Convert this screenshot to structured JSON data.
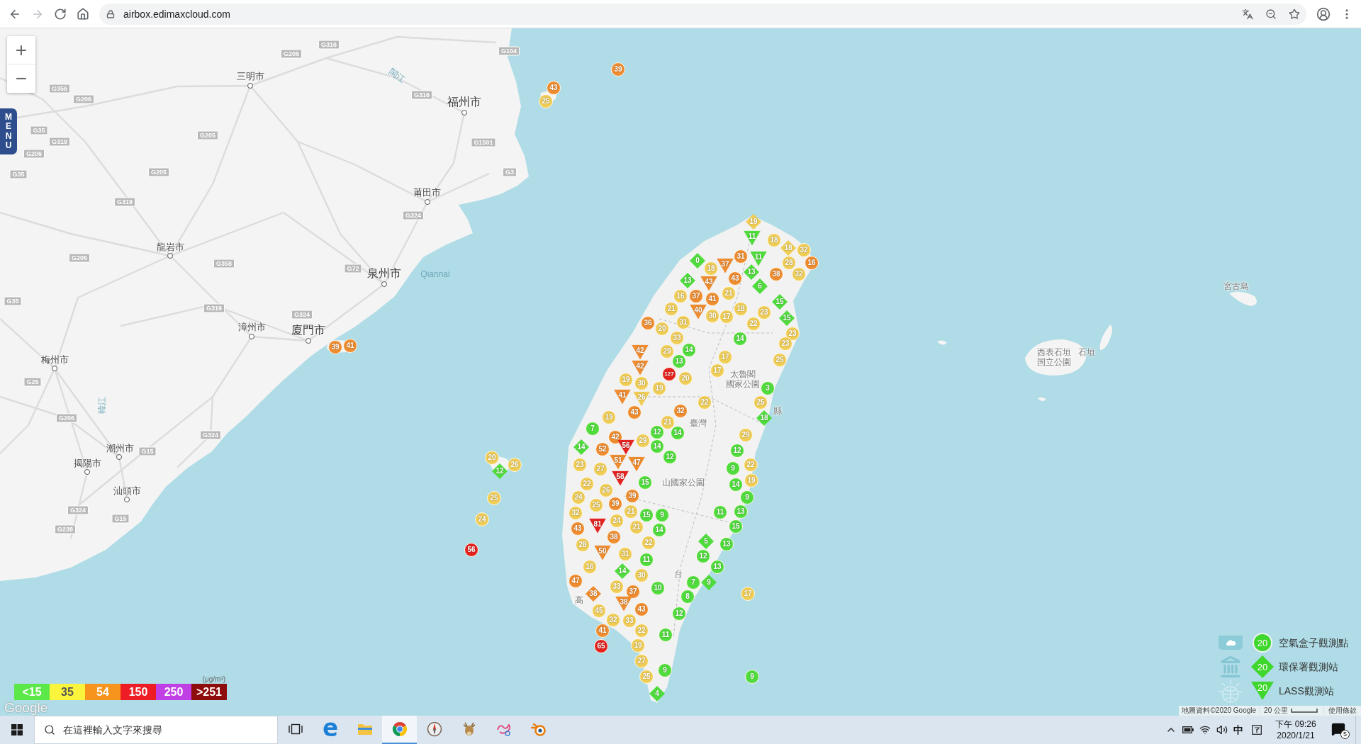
{
  "browser": {
    "url": "airbox.edimaxcloud.com"
  },
  "map": {
    "zoom_controls": [
      "+",
      "−"
    ],
    "menu_tab": "MENU",
    "city_labels": [
      {
        "name": "三明市",
        "kind": "city"
      },
      {
        "name": "福州市",
        "kind": "major_city"
      },
      {
        "name": "莆田市",
        "kind": "city"
      },
      {
        "name": "龍岩市",
        "kind": "city"
      },
      {
        "name": "泉州市",
        "kind": "major_city"
      },
      {
        "name": "漳州市",
        "kind": "city"
      },
      {
        "name": "廈門市",
        "kind": "major_city"
      },
      {
        "name": "梅州市",
        "kind": "city"
      },
      {
        "name": "潮州市",
        "kind": "city"
      },
      {
        "name": "揭陽市",
        "kind": "city"
      },
      {
        "name": "汕頭市",
        "kind": "city"
      }
    ],
    "road_labels": [
      "G316",
      "G205",
      "G104",
      "G356",
      "G206",
      "G316",
      "G35",
      "G205",
      "G319",
      "G1501",
      "G206",
      "G35",
      "G205",
      "G3",
      "G319",
      "G324",
      "G205",
      "G358",
      "G72",
      "G35",
      "G319",
      "G324",
      "G25",
      "G206",
      "G324",
      "G15",
      "G324",
      "G15",
      "G238"
    ],
    "water_labels": [
      "閩江",
      "韓江",
      "Qiannai"
    ],
    "place_labels": [
      "太魯閣",
      "國家公園",
      "臺灣",
      "山國家公園",
      "縣",
      "高",
      "台",
      "宮古島",
      "西表石垣",
      "国立公園",
      "石垣"
    ],
    "markers": [
      {
        "kind": "circle",
        "value": "39",
        "color": "#ef8c2f"
      },
      {
        "kind": "circle",
        "value": "43",
        "color": "#ef8c2f"
      },
      {
        "kind": "circle",
        "value": "25",
        "color": "#f0cd55"
      },
      {
        "kind": "diamond",
        "value": "19",
        "color": "#f0cd55"
      },
      {
        "kind": "triangle",
        "value": "11",
        "color": "#4fdc3c"
      },
      {
        "kind": "circle",
        "value": "18",
        "color": "#f0cd55"
      },
      {
        "kind": "diamond",
        "value": "18",
        "color": "#f0cd55"
      },
      {
        "kind": "circle",
        "value": "32",
        "color": "#f0cd55"
      },
      {
        "kind": "diamond",
        "value": "0",
        "color": "#4fdc3c"
      },
      {
        "kind": "circle",
        "value": "18",
        "color": "#f0cd55"
      },
      {
        "kind": "triangle",
        "value": "37",
        "color": "#ef8c2f"
      },
      {
        "kind": "circle",
        "value": "31",
        "color": "#ef8c2f"
      },
      {
        "kind": "diamond",
        "value": "13",
        "color": "#4fdc3c"
      },
      {
        "kind": "triangle",
        "value": "11",
        "color": "#4fdc3c"
      },
      {
        "kind": "circle",
        "value": "28",
        "color": "#f0cd55"
      },
      {
        "kind": "circle",
        "value": "16",
        "color": "#ef8c2f"
      },
      {
        "kind": "diamond",
        "value": "13",
        "color": "#4fdc3c"
      },
      {
        "kind": "circle",
        "value": "43",
        "color": "#ef8c2f"
      },
      {
        "kind": "circle",
        "value": "38",
        "color": "#ef8c2f"
      },
      {
        "kind": "circle",
        "value": "32",
        "color": "#f0cd55"
      },
      {
        "kind": "triangle",
        "value": "43",
        "color": "#ef8c2f"
      },
      {
        "kind": "diamond",
        "value": "6",
        "color": "#4fdc3c"
      },
      {
        "kind": "circle",
        "value": "16",
        "color": "#f0cd55"
      },
      {
        "kind": "circle",
        "value": "37",
        "color": "#ef8c2f"
      },
      {
        "kind": "circle",
        "value": "41",
        "color": "#ef8c2f"
      },
      {
        "kind": "circle",
        "value": "21",
        "color": "#f0cd55"
      },
      {
        "kind": "diamond",
        "value": "15",
        "color": "#4fdc3c"
      },
      {
        "kind": "circle",
        "value": "21",
        "color": "#f0cd55"
      },
      {
        "kind": "triangle",
        "value": "40",
        "color": "#ef8c2f"
      },
      {
        "kind": "circle",
        "value": "18",
        "color": "#f0cd55"
      },
      {
        "kind": "circle",
        "value": "23",
        "color": "#f0cd55"
      },
      {
        "kind": "circle",
        "value": "36",
        "color": "#ef8c2f"
      },
      {
        "kind": "circle",
        "value": "20",
        "color": "#f0cd55"
      },
      {
        "kind": "circle",
        "value": "31",
        "color": "#f0cd55"
      },
      {
        "kind": "circle",
        "value": "30",
        "color": "#f0cd55"
      },
      {
        "kind": "circle",
        "value": "17",
        "color": "#f0cd55"
      },
      {
        "kind": "circle",
        "value": "22",
        "color": "#f0cd55"
      },
      {
        "kind": "diamond",
        "value": "15",
        "color": "#4fdc3c"
      },
      {
        "kind": "circle",
        "value": "33",
        "color": "#f0cd55"
      },
      {
        "kind": "circle",
        "value": "14",
        "color": "#4fdc3c"
      },
      {
        "kind": "circle",
        "value": "23",
        "color": "#f0cd55"
      },
      {
        "kind": "circle",
        "value": "39",
        "color": "#ef8c2f"
      },
      {
        "kind": "circle",
        "value": "41",
        "color": "#ef8c2f"
      },
      {
        "kind": "circle",
        "value": "14",
        "color": "#4fdc3c"
      },
      {
        "kind": "circle",
        "value": "23",
        "color": "#f0cd55"
      },
      {
        "kind": "triangle",
        "value": "42",
        "color": "#ef8c2f"
      },
      {
        "kind": "circle",
        "value": "29",
        "color": "#f0cd55"
      },
      {
        "kind": "circle",
        "value": "13",
        "color": "#4fdc3c"
      },
      {
        "kind": "circle",
        "value": "17",
        "color": "#f0cd55"
      },
      {
        "kind": "circle",
        "value": "25",
        "color": "#f0cd55"
      },
      {
        "kind": "triangle",
        "value": "42",
        "color": "#ef8c2f"
      },
      {
        "kind": "circle",
        "value": "127",
        "color": "#e42320"
      },
      {
        "kind": "circle",
        "value": "17",
        "color": "#f0cd55"
      },
      {
        "kind": "circle",
        "value": "19",
        "color": "#f0cd55"
      },
      {
        "kind": "circle",
        "value": "30",
        "color": "#f0cd55"
      },
      {
        "kind": "circle",
        "value": "20",
        "color": "#f0cd55"
      },
      {
        "kind": "circle",
        "value": "19",
        "color": "#f0cd55"
      },
      {
        "kind": "circle",
        "value": "3",
        "color": "#4fdc3c"
      },
      {
        "kind": "triangle",
        "value": "41",
        "color": "#ef8c2f"
      },
      {
        "kind": "triangle",
        "value": "26",
        "color": "#f0cd55"
      },
      {
        "kind": "circle",
        "value": "22",
        "color": "#f0cd55"
      },
      {
        "kind": "circle",
        "value": "25",
        "color": "#f0cd55"
      },
      {
        "kind": "circle",
        "value": "19",
        "color": "#f0cd55"
      },
      {
        "kind": "circle",
        "value": "43",
        "color": "#ef8c2f"
      },
      {
        "kind": "circle",
        "value": "32",
        "color": "#ef8c2f"
      },
      {
        "kind": "circle",
        "value": "21",
        "color": "#f0cd55"
      },
      {
        "kind": "diamond",
        "value": "18",
        "color": "#4fdc3c"
      },
      {
        "kind": "circle",
        "value": "7",
        "color": "#4fdc3c"
      },
      {
        "kind": "circle",
        "value": "42",
        "color": "#ef8c2f"
      },
      {
        "kind": "circle",
        "value": "29",
        "color": "#f0cd55"
      },
      {
        "kind": "circle",
        "value": "12",
        "color": "#4fdc3c"
      },
      {
        "kind": "circle",
        "value": "14",
        "color": "#4fdc3c"
      },
      {
        "kind": "circle",
        "value": "29",
        "color": "#f0cd55"
      },
      {
        "kind": "diamond",
        "value": "14",
        "color": "#4fdc3c"
      },
      {
        "kind": "circle",
        "value": "52",
        "color": "#ef8c2f"
      },
      {
        "kind": "triangle",
        "value": "56",
        "color": "#e42320"
      },
      {
        "kind": "circle",
        "value": "14",
        "color": "#4fdc3c"
      },
      {
        "kind": "circle",
        "value": "12",
        "color": "#4fdc3c"
      },
      {
        "kind": "circle",
        "value": "20",
        "color": "#f0cd55"
      },
      {
        "kind": "triangle",
        "value": "51",
        "color": "#ef8c2f"
      },
      {
        "kind": "circle",
        "value": "12",
        "color": "#4fdc3c"
      },
      {
        "kind": "circle",
        "value": "26",
        "color": "#f0cd55"
      },
      {
        "kind": "circle",
        "value": "23",
        "color": "#f0cd55"
      },
      {
        "kind": "circle",
        "value": "27",
        "color": "#f0cd55"
      },
      {
        "kind": "triangle",
        "value": "47",
        "color": "#ef8c2f"
      },
      {
        "kind": "circle",
        "value": "9",
        "color": "#4fdc3c"
      },
      {
        "kind": "circle",
        "value": "22",
        "color": "#f0cd55"
      },
      {
        "kind": "diamond",
        "value": "12",
        "color": "#4fdc3c"
      },
      {
        "kind": "circle",
        "value": "22",
        "color": "#f0cd55"
      },
      {
        "kind": "triangle",
        "value": "58",
        "color": "#e42320"
      },
      {
        "kind": "circle",
        "value": "15",
        "color": "#4fdc3c"
      },
      {
        "kind": "circle",
        "value": "14",
        "color": "#4fdc3c"
      },
      {
        "kind": "circle",
        "value": "19",
        "color": "#f0cd55"
      },
      {
        "kind": "circle",
        "value": "25",
        "color": "#f0cd55"
      },
      {
        "kind": "circle",
        "value": "24",
        "color": "#f0cd55"
      },
      {
        "kind": "circle",
        "value": "26",
        "color": "#f0cd55"
      },
      {
        "kind": "circle",
        "value": "39",
        "color": "#ef8c2f"
      },
      {
        "kind": "circle",
        "value": "39",
        "color": "#ef8c2f"
      },
      {
        "kind": "circle",
        "value": "9",
        "color": "#4fdc3c"
      },
      {
        "kind": "circle",
        "value": "32",
        "color": "#f0cd55"
      },
      {
        "kind": "circle",
        "value": "25",
        "color": "#f0cd55"
      },
      {
        "kind": "circle",
        "value": "21",
        "color": "#f0cd55"
      },
      {
        "kind": "circle",
        "value": "15",
        "color": "#4fdc3c"
      },
      {
        "kind": "circle",
        "value": "9",
        "color": "#4fdc3c"
      },
      {
        "kind": "circle",
        "value": "11",
        "color": "#4fdc3c"
      },
      {
        "kind": "circle",
        "value": "13",
        "color": "#4fdc3c"
      },
      {
        "kind": "circle",
        "value": "24",
        "color": "#f0cd55"
      },
      {
        "kind": "triangle",
        "value": "81",
        "color": "#e42320"
      },
      {
        "kind": "circle",
        "value": "24",
        "color": "#f0cd55"
      },
      {
        "kind": "circle",
        "value": "43",
        "color": "#ef8c2f"
      },
      {
        "kind": "circle",
        "value": "21",
        "color": "#f0cd55"
      },
      {
        "kind": "circle",
        "value": "14",
        "color": "#4fdc3c"
      },
      {
        "kind": "circle",
        "value": "15",
        "color": "#4fdc3c"
      },
      {
        "kind": "circle",
        "value": "38",
        "color": "#ef8c2f"
      },
      {
        "kind": "circle",
        "value": "22",
        "color": "#f0cd55"
      },
      {
        "kind": "diamond",
        "value": "5",
        "color": "#4fdc3c"
      },
      {
        "kind": "circle",
        "value": "56",
        "color": "#e42320"
      },
      {
        "kind": "circle",
        "value": "28",
        "color": "#f0cd55"
      },
      {
        "kind": "circle",
        "value": "13",
        "color": "#4fdc3c"
      },
      {
        "kind": "triangle",
        "value": "50",
        "color": "#ef8c2f"
      },
      {
        "kind": "circle",
        "value": "31",
        "color": "#f0cd55"
      },
      {
        "kind": "circle",
        "value": "11",
        "color": "#4fdc3c"
      },
      {
        "kind": "circle",
        "value": "12",
        "color": "#4fdc3c"
      },
      {
        "kind": "circle",
        "value": "16",
        "color": "#f0cd55"
      },
      {
        "kind": "diamond",
        "value": "14",
        "color": "#4fdc3c"
      },
      {
        "kind": "circle",
        "value": "13",
        "color": "#4fdc3c"
      },
      {
        "kind": "circle",
        "value": "47",
        "color": "#ef8c2f"
      },
      {
        "kind": "circle",
        "value": "30",
        "color": "#f0cd55"
      },
      {
        "kind": "circle",
        "value": "33",
        "color": "#f0cd55"
      },
      {
        "kind": "circle",
        "value": "10",
        "color": "#4fdc3c"
      },
      {
        "kind": "circle",
        "value": "7",
        "color": "#4fdc3c"
      },
      {
        "kind": "diamond",
        "value": "9",
        "color": "#4fdc3c"
      },
      {
        "kind": "diamond",
        "value": "38",
        "color": "#ef8c2f"
      },
      {
        "kind": "circle",
        "value": "37",
        "color": "#ef8c2f"
      },
      {
        "kind": "circle",
        "value": "8",
        "color": "#4fdc3c"
      },
      {
        "kind": "circle",
        "value": "17",
        "color": "#f0cd55"
      },
      {
        "kind": "circle",
        "value": "45",
        "color": "#f0cd55"
      },
      {
        "kind": "triangle",
        "value": "38",
        "color": "#ef8c2f"
      },
      {
        "kind": "circle",
        "value": "43",
        "color": "#ef8c2f"
      },
      {
        "kind": "circle",
        "value": "12",
        "color": "#4fdc3c"
      },
      {
        "kind": "circle",
        "value": "32",
        "color": "#f0cd55"
      },
      {
        "kind": "circle",
        "value": "33",
        "color": "#f0cd55"
      },
      {
        "kind": "circle",
        "value": "41",
        "color": "#ef8c2f"
      },
      {
        "kind": "circle",
        "value": "22",
        "color": "#f0cd55"
      },
      {
        "kind": "circle",
        "value": "11",
        "color": "#4fdc3c"
      },
      {
        "kind": "circle",
        "value": "65",
        "color": "#e42320"
      },
      {
        "kind": "circle",
        "value": "19",
        "color": "#f0cd55"
      },
      {
        "kind": "circle",
        "value": "27",
        "color": "#f0cd55"
      },
      {
        "kind": "circle",
        "value": "25",
        "color": "#f0cd55"
      },
      {
        "kind": "circle",
        "value": "9",
        "color": "#4fdc3c"
      },
      {
        "kind": "circle",
        "value": "9",
        "color": "#4fdc3c"
      },
      {
        "kind": "diamond",
        "value": "4",
        "color": "#4fdc3c"
      }
    ],
    "concentration_legend": {
      "unit": "(μg/m³)",
      "items": [
        {
          "label": "<15",
          "color": "#5de84a"
        },
        {
          "label": "35",
          "color": "#fbf43c"
        },
        {
          "label": "54",
          "color": "#f7941d"
        },
        {
          "label": "150",
          "color": "#ee1c25"
        },
        {
          "label": "250",
          "color": "#c040e6"
        },
        {
          "label": ">251",
          "color": "#8e0c0c"
        }
      ]
    },
    "station_legend": [
      {
        "kind": "airbox",
        "marker_value": "20",
        "label": "空氣盒子觀測點"
      },
      {
        "kind": "epa",
        "marker_value": "20",
        "label": "環保署觀測站"
      },
      {
        "kind": "lass",
        "marker_value": "20",
        "label": "LASS觀測站"
      }
    ],
    "logo": "Google",
    "attribution": {
      "data": "地圖資料©2020 Google",
      "scale": "20 公里",
      "terms": "使用條款"
    }
  },
  "taskbar": {
    "search_placeholder": "在這裡輸入文字來搜尋",
    "apps": [
      {
        "kind": "task_view",
        "selected": false
      },
      {
        "kind": "edge",
        "selected": false
      },
      {
        "kind": "explorer",
        "selected": false
      },
      {
        "kind": "chrome",
        "selected": true
      },
      {
        "kind": "compass",
        "selected": false
      },
      {
        "kind": "deer",
        "selected": false
      },
      {
        "kind": "paint",
        "selected": false
      },
      {
        "kind": "blender",
        "selected": false
      }
    ],
    "input_method": "中",
    "time": "下午 09:26",
    "date": "2020/1/21",
    "notification_count": "5"
  }
}
